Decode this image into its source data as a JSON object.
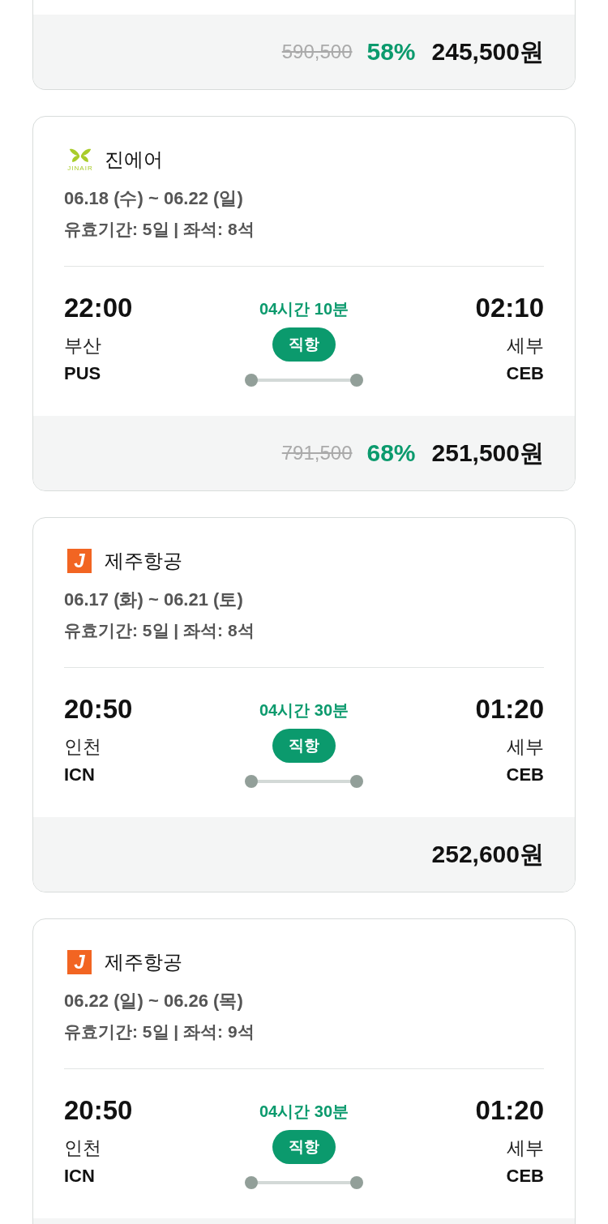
{
  "cards": [
    {
      "kind": "partial",
      "price": {
        "original": "590,500",
        "discount": "58%",
        "amount": "245,500원"
      }
    },
    {
      "kind": "full",
      "airline": {
        "name": "진에어",
        "logo": {
          "kind": "butterfly",
          "text": "JINAIR"
        }
      },
      "dates": "06.18 (수) ~ 06.22 (일)",
      "details": "유효기간: 5일 | 좌석: 8석",
      "departure": {
        "time": "22:00",
        "city": "부산",
        "code": "PUS"
      },
      "duration": "04시간 10분",
      "route_type": "직항",
      "arrival": {
        "time": "02:10",
        "city": "세부",
        "code": "CEB"
      },
      "price": {
        "original": "791,500",
        "discount": "68%",
        "amount": "251,500원"
      }
    },
    {
      "kind": "full",
      "airline": {
        "name": "제주항공",
        "logo": {
          "kind": "tile",
          "text": "J"
        }
      },
      "dates": "06.17 (화) ~ 06.21 (토)",
      "details": "유효기간: 5일 | 좌석: 8석",
      "departure": {
        "time": "20:50",
        "city": "인천",
        "code": "ICN"
      },
      "duration": "04시간 30분",
      "route_type": "직항",
      "arrival": {
        "time": "01:20",
        "city": "세부",
        "code": "CEB"
      },
      "price": {
        "amount": "252,600원"
      }
    },
    {
      "kind": "full",
      "airline": {
        "name": "제주항공",
        "logo": {
          "kind": "tile",
          "text": "J"
        }
      },
      "dates": "06.22 (일) ~ 06.26 (목)",
      "details": "유효기간: 5일 | 좌석: 9석",
      "departure": {
        "time": "20:50",
        "city": "인천",
        "code": "ICN"
      },
      "duration": "04시간 30분",
      "route_type": "직항",
      "arrival": {
        "time": "01:20",
        "city": "세부",
        "code": "CEB"
      }
    }
  ]
}
